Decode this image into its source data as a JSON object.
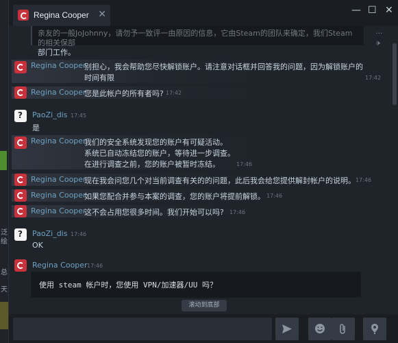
{
  "window": {
    "tab_title": "Regina Cooper",
    "tab_close": "✕",
    "minimize": "—",
    "maximize": "☐",
    "close": "✕"
  },
  "side_text": {
    "a": "泛",
    "b": "绘",
    "c": "总",
    "d": "天"
  },
  "quote": {
    "line1": "亲友的一般JoJohnny，请勿予一致评一由原因的信息，它由Steam的团队来确定，我们Steam的相关保部",
    "line2": "部门工作。"
  },
  "messages": [
    {
      "name": "Regina Cooper",
      "lines": [
        "别担心，我会帮助您尽快解锁账户。请注意对话框并回答我的问题，因为解锁账户的",
        "时间有限"
      ],
      "time": "17:42"
    },
    {
      "name": "Regina Cooper",
      "lines": [
        "您是此帐户的所有者吗?"
      ],
      "time": "17:42"
    },
    {
      "name": "PaoZi_dis",
      "time": "17:45",
      "lines": [
        "是"
      ]
    },
    {
      "name": "Regina Cooper",
      "lines": [
        "我们的安全系统发现您的账户有可疑活动。",
        "系统已自动冻结您的账户，等待进一步调查。",
        "在进行调查之前，您的账户被暂时冻结。"
      ],
      "time": "17:46"
    },
    {
      "name": "Regina Cooper",
      "lines": [
        "现在我会问您几个对当前调查有关的的问题，此后我会给您提供解封帐户的说明。"
      ],
      "time": "17:46"
    },
    {
      "name": "Regina Cooper",
      "lines": [
        "如果您配合并参与本案的调查，您的账户将提前解锁。"
      ],
      "time": "17:46"
    },
    {
      "name": "Regina Cooper",
      "lines": [
        "这不会占用您很多时间。我们开始可以吗?"
      ],
      "time": "17:46"
    },
    {
      "name": "PaoZi_dis",
      "time": "17:46",
      "lines": [
        "OK"
      ]
    },
    {
      "name": "Regina Cooper",
      "time": "17:46",
      "code": "使用 steam 帐户时，您使用 VPN/加速器/UU 吗？"
    }
  ],
  "scroll_down_label": "滚动到底部",
  "input": {
    "placeholder": ""
  },
  "icons": {
    "send": "send-icon",
    "emoji": "emoji-icon",
    "attach": "paperclip-icon",
    "voice": "microphone-icon"
  }
}
